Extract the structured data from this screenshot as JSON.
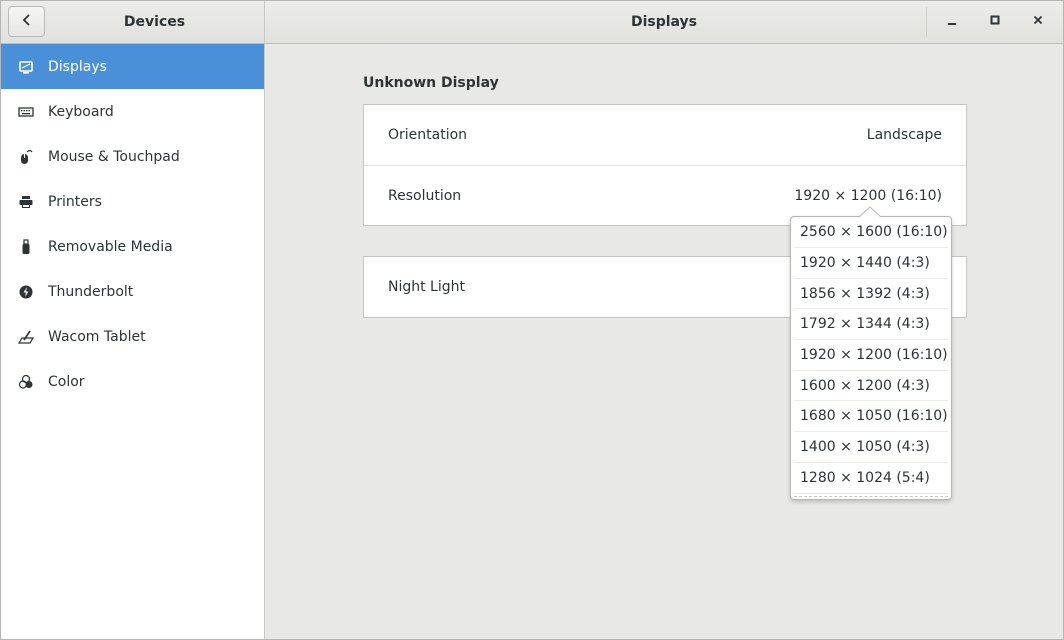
{
  "header": {
    "left_title": "Devices",
    "title": "Displays",
    "back_icon": "chevron-left-icon",
    "window_buttons": [
      "minimize-icon",
      "maximize-icon",
      "close-icon"
    ]
  },
  "sidebar": {
    "items": [
      {
        "label": "Displays",
        "icon": "display-icon",
        "selected": true
      },
      {
        "label": "Keyboard",
        "icon": "keyboard-icon",
        "selected": false
      },
      {
        "label": "Mouse & Touchpad",
        "icon": "mouse-icon",
        "selected": false
      },
      {
        "label": "Printers",
        "icon": "printer-icon",
        "selected": false
      },
      {
        "label": "Removable Media",
        "icon": "usb-icon",
        "selected": false
      },
      {
        "label": "Thunderbolt",
        "icon": "thunderbolt-icon",
        "selected": false
      },
      {
        "label": "Wacom Tablet",
        "icon": "tablet-icon",
        "selected": false
      },
      {
        "label": "Color",
        "icon": "color-icon",
        "selected": false
      }
    ]
  },
  "main": {
    "section_title": "Unknown Display",
    "settings": [
      {
        "label": "Orientation",
        "value": "Landscape"
      },
      {
        "label": "Resolution",
        "value": "1920 × 1200 (16:10)"
      }
    ],
    "night_light": {
      "label": "Night Light"
    }
  },
  "resolution_popover": {
    "options": [
      "2560 × 1600 (16:10)",
      "1920 × 1440 (4:3)",
      "1856 × 1392 (4:3)",
      "1792 × 1344 (4:3)",
      "1920 × 1200 (16:10)",
      "1600 × 1200 (4:3)",
      "1680 × 1050 (16:10)",
      "1400 × 1050 (4:3)",
      "1280 × 1024 (5:4)"
    ]
  },
  "colors": {
    "accent": "#4a90d9",
    "sidebar_bg": "#ffffff",
    "content_bg": "#e8e8e7",
    "text": "#2e3436"
  }
}
